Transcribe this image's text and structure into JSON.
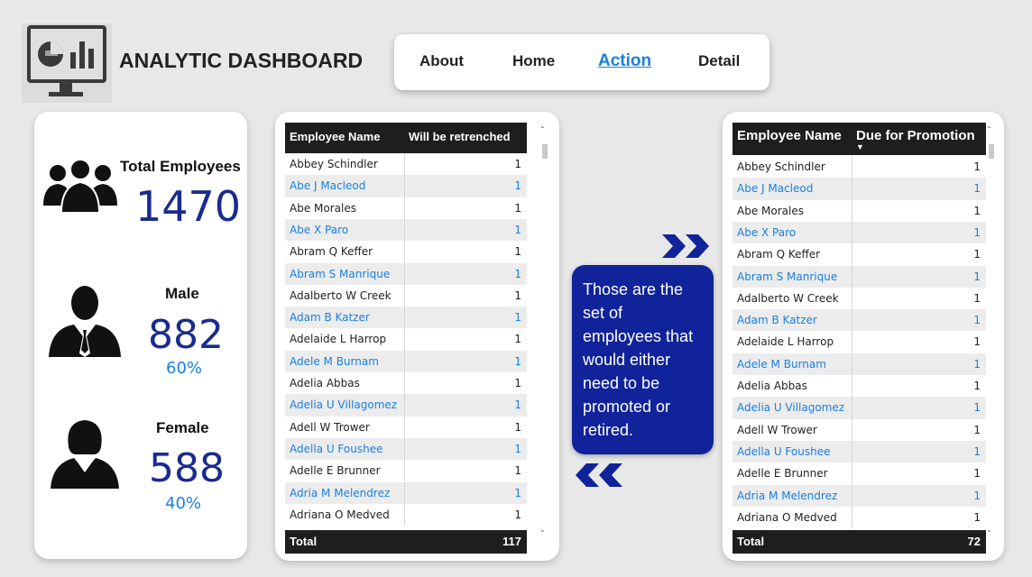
{
  "header": {
    "title": "ANALYTIC DASHBOARD",
    "nav": [
      "About",
      "Home",
      "Action",
      "Detail"
    ],
    "active_nav": "Action"
  },
  "kpis": {
    "total_label": "Total Employees",
    "total_value": "1470",
    "male_label": "Male",
    "male_value": "882",
    "male_pct": "60%",
    "female_label": "Female",
    "female_value": "588",
    "female_pct": "40%"
  },
  "table_left": {
    "col1": "Employee Name",
    "col2": "Will be retrenched",
    "rows": [
      {
        "name": "Abbey Schindler",
        "value": "1"
      },
      {
        "name": "Abe J Macleod",
        "value": "1"
      },
      {
        "name": "Abe Morales",
        "value": "1"
      },
      {
        "name": "Abe X Paro",
        "value": "1"
      },
      {
        "name": "Abram Q Keffer",
        "value": "1"
      },
      {
        "name": "Abram S Manrique",
        "value": "1"
      },
      {
        "name": "Adalberto W Creek",
        "value": "1"
      },
      {
        "name": "Adam B Katzer",
        "value": "1"
      },
      {
        "name": "Adelaide L Harrop",
        "value": "1"
      },
      {
        "name": "Adele M Burnam",
        "value": "1"
      },
      {
        "name": "Adelia Abbas",
        "value": "1"
      },
      {
        "name": "Adelia U Villagomez",
        "value": "1"
      },
      {
        "name": "Adell W Trower",
        "value": "1"
      },
      {
        "name": "Adella U Foushee",
        "value": "1"
      },
      {
        "name": "Adelle E Brunner",
        "value": "1"
      },
      {
        "name": "Adria M Melendrez",
        "value": "1"
      },
      {
        "name": "Adriana O Medved",
        "value": "1"
      }
    ],
    "total_label": "Total",
    "total_value": "117"
  },
  "table_right": {
    "col1": "Employee Name",
    "col2": "Due for Promotion",
    "rows": [
      {
        "name": "Abbey Schindler",
        "value": "1"
      },
      {
        "name": "Abe J Macleod",
        "value": "1"
      },
      {
        "name": "Abe Morales",
        "value": "1"
      },
      {
        "name": "Abe X Paro",
        "value": "1"
      },
      {
        "name": "Abram Q Keffer",
        "value": "1"
      },
      {
        "name": "Abram S Manrique",
        "value": "1"
      },
      {
        "name": "Adalberto W Creek",
        "value": "1"
      },
      {
        "name": "Adam B Katzer",
        "value": "1"
      },
      {
        "name": "Adelaide L Harrop",
        "value": "1"
      },
      {
        "name": "Adele M Burnam",
        "value": "1"
      },
      {
        "name": "Adelia Abbas",
        "value": "1"
      },
      {
        "name": "Adelia U Villagomez",
        "value": "1"
      },
      {
        "name": "Adell W Trower",
        "value": "1"
      },
      {
        "name": "Adella U Foushee",
        "value": "1"
      },
      {
        "name": "Adelle E Brunner",
        "value": "1"
      },
      {
        "name": "Adria M Melendrez",
        "value": "1"
      },
      {
        "name": "Adriana O Medved",
        "value": "1"
      }
    ],
    "total_label": "Total",
    "total_value": "72"
  },
  "callout": {
    "text": "Those are the set of employees that would either need to be promoted or retired."
  },
  "colors": {
    "accent_blue": "#1a7fe0",
    "navy": "#1a2b8f",
    "callout_bg": "#10239a",
    "table_header": "#1e1e1e"
  },
  "icons": [
    "dashboard-monitor-icon",
    "group-icon",
    "male-user-icon",
    "female-user-icon",
    "chevron-right-double-icon",
    "chevron-left-double-icon",
    "sort-down-icon"
  ]
}
